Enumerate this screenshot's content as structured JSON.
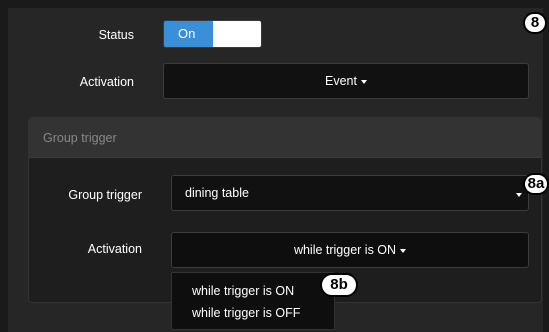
{
  "status": {
    "label": "Status",
    "toggle_on_label": "On",
    "state": "on"
  },
  "activation": {
    "label": "Activation",
    "value": "Event"
  },
  "group_panel": {
    "header": "Group trigger",
    "group_trigger": {
      "label": "Group trigger",
      "value": "dining table"
    },
    "activation": {
      "label": "Activation",
      "value": "while trigger is ON"
    }
  },
  "activation_menu": {
    "options": [
      "while trigger is ON",
      "while trigger is OFF"
    ]
  },
  "callouts": {
    "main": "8",
    "group": "8a",
    "menu": "8b"
  },
  "colors": {
    "accent": "#3a8fd9",
    "background": "#262626",
    "panel": "#1e1e1e"
  }
}
